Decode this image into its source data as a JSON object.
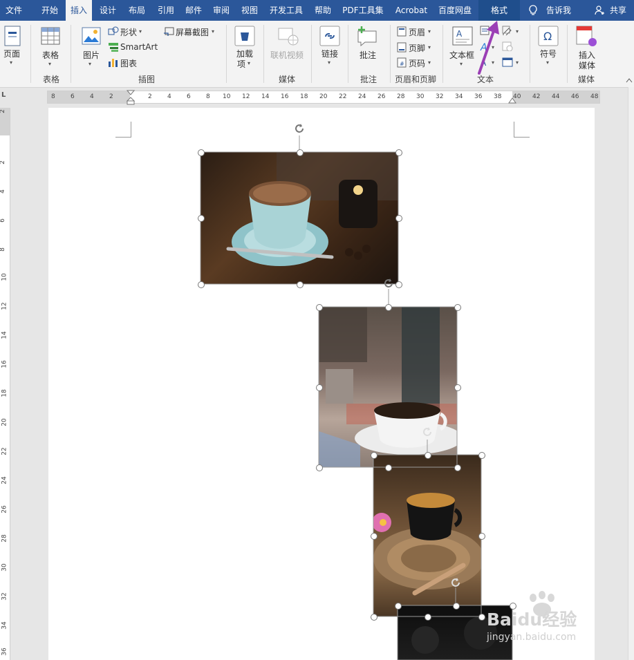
{
  "tabs": [
    {
      "label": "文件"
    },
    {
      "label": "开始"
    },
    {
      "label": "插入",
      "active": true
    },
    {
      "label": "设计"
    },
    {
      "label": "布局"
    },
    {
      "label": "引用"
    },
    {
      "label": "邮件"
    },
    {
      "label": "审阅"
    },
    {
      "label": "视图"
    },
    {
      "label": "开发工具"
    },
    {
      "label": "帮助"
    },
    {
      "label": "PDF工具集"
    },
    {
      "label": "Acrobat"
    },
    {
      "label": "百度网盘"
    },
    {
      "label": "格式"
    }
  ],
  "tell_me": "告诉我",
  "share": "共享",
  "ribbon": {
    "page": {
      "label": "页面"
    },
    "table": {
      "label": "表格",
      "group": "表格"
    },
    "picture": {
      "label": "图片"
    },
    "shapes": {
      "label": "形状"
    },
    "smartart": {
      "label": "SmartArt"
    },
    "chart": {
      "label": "图表"
    },
    "screenshot": {
      "label": "屏幕截图"
    },
    "illustrations_group": "插图",
    "addins": {
      "label_line1": "加载",
      "label_line2": "项"
    },
    "online_video": {
      "label": "联机视频"
    },
    "media_group": "媒体",
    "link": {
      "label": "链接"
    },
    "comment": {
      "label": "批注",
      "group": "批注"
    },
    "header": {
      "label": "页眉"
    },
    "footer": {
      "label": "页脚"
    },
    "page_number": {
      "label": "页码"
    },
    "header_footer_group": "页眉和页脚",
    "textbox": {
      "label": "文本框"
    },
    "text_group": "文本",
    "symbol": {
      "label": "符号"
    },
    "insert_media": {
      "label_line1": "插入",
      "label_line2": "媒体",
      "group": "媒体"
    }
  },
  "ruler_numbers": [
    "8",
    "6",
    "4",
    "2",
    "2",
    "4",
    "6",
    "8",
    "10",
    "12",
    "14",
    "16",
    "18",
    "20",
    "22",
    "24",
    "26",
    "28",
    "30",
    "32",
    "34",
    "36",
    "38",
    "40",
    "42",
    "44",
    "46",
    "48"
  ],
  "vruler_numbers": [
    "2",
    "2",
    "4",
    "6",
    "8",
    "10",
    "12",
    "14",
    "16",
    "18",
    "20",
    "22",
    "24",
    "26",
    "28",
    "30",
    "32",
    "34",
    "36"
  ],
  "watermark": {
    "main": "Baidu经验",
    "url": "jingyan.baidu.com"
  },
  "colors": {
    "title_bar": "#2b579a",
    "arrow": "#9b3fb5"
  }
}
